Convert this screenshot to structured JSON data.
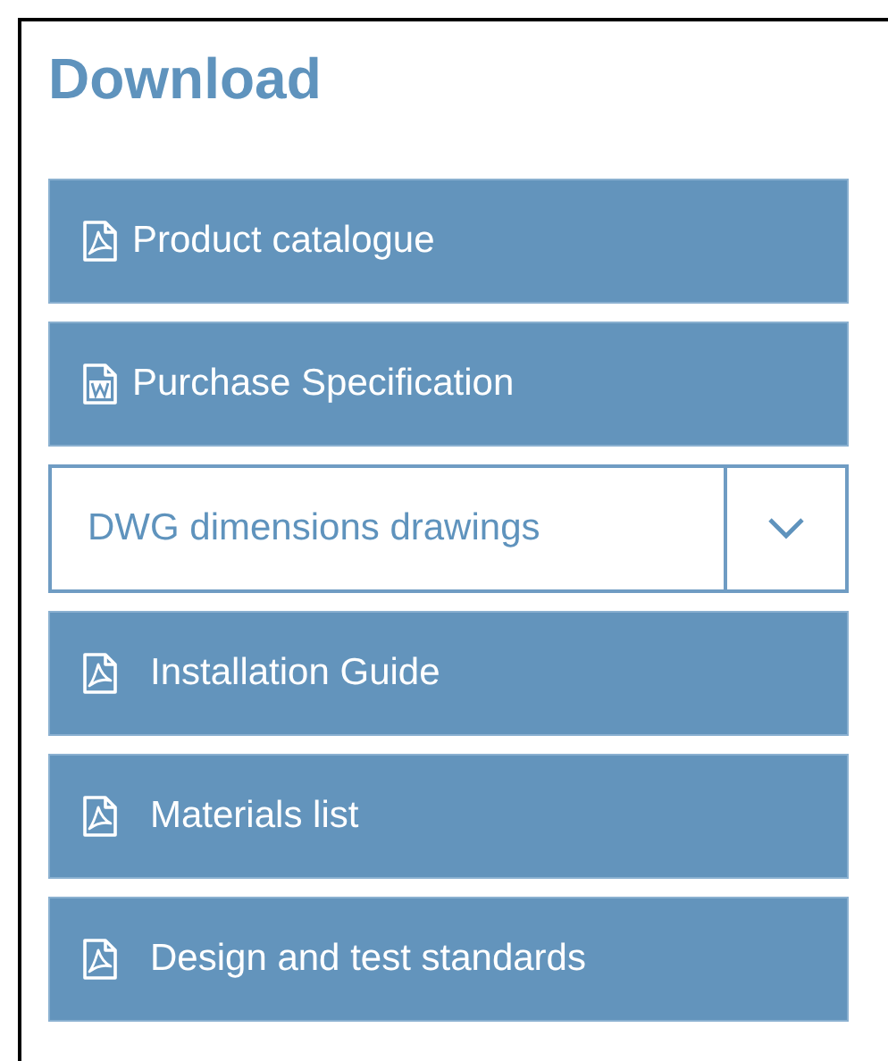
{
  "title": "Download",
  "items": [
    {
      "kind": "pdf",
      "label": "Product catalogue"
    },
    {
      "kind": "word",
      "label": "Purchase Specification"
    },
    {
      "kind": "dropdown",
      "label": "DWG dimensions drawings"
    },
    {
      "kind": "pdf",
      "label": "Installation Guide"
    },
    {
      "kind": "pdf",
      "label": "Materials list"
    },
    {
      "kind": "pdf",
      "label": "Design and test standards"
    }
  ]
}
